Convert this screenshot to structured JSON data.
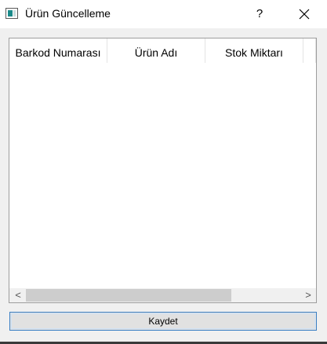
{
  "window": {
    "title": "Ürün Güncelleme",
    "help_label": "?"
  },
  "table": {
    "columns": [
      "Barkod Numarası",
      "Ürün Adı",
      "Stok Miktarı",
      ""
    ],
    "rows": []
  },
  "scrollbar": {
    "left_arrow": "<",
    "right_arrow": ">"
  },
  "actions": {
    "save_label": "Kaydet"
  },
  "colors": {
    "titlebar_bg": "#ffffff",
    "window_bg": "#f0f0f0",
    "button_focus_border": "#3a7fc4",
    "scroll_thumb": "#cdcdcd"
  }
}
